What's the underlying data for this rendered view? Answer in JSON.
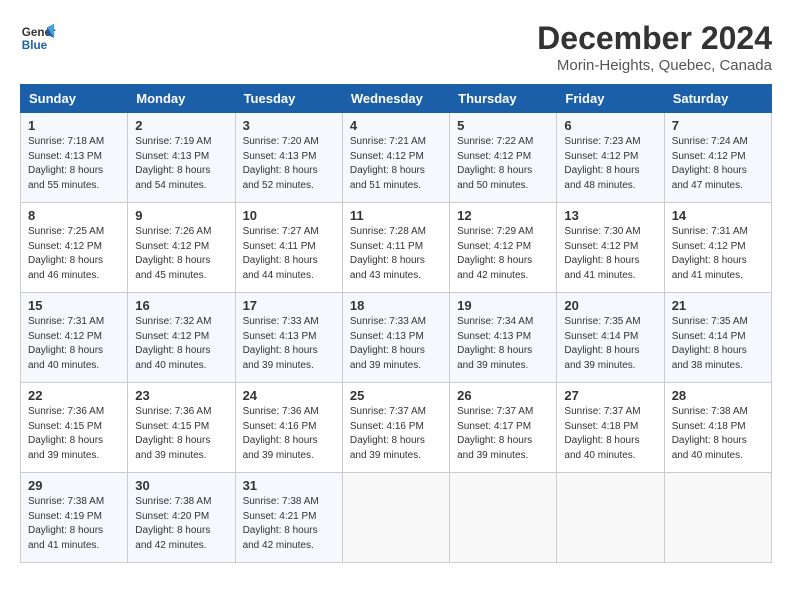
{
  "header": {
    "logo_line1": "General",
    "logo_line2": "Blue",
    "month": "December 2024",
    "location": "Morin-Heights, Quebec, Canada"
  },
  "columns": [
    "Sunday",
    "Monday",
    "Tuesday",
    "Wednesday",
    "Thursday",
    "Friday",
    "Saturday"
  ],
  "weeks": [
    [
      {
        "day": "1",
        "sunrise": "Sunrise: 7:18 AM",
        "sunset": "Sunset: 4:13 PM",
        "daylight": "Daylight: 8 hours and 55 minutes."
      },
      {
        "day": "2",
        "sunrise": "Sunrise: 7:19 AM",
        "sunset": "Sunset: 4:13 PM",
        "daylight": "Daylight: 8 hours and 54 minutes."
      },
      {
        "day": "3",
        "sunrise": "Sunrise: 7:20 AM",
        "sunset": "Sunset: 4:13 PM",
        "daylight": "Daylight: 8 hours and 52 minutes."
      },
      {
        "day": "4",
        "sunrise": "Sunrise: 7:21 AM",
        "sunset": "Sunset: 4:12 PM",
        "daylight": "Daylight: 8 hours and 51 minutes."
      },
      {
        "day": "5",
        "sunrise": "Sunrise: 7:22 AM",
        "sunset": "Sunset: 4:12 PM",
        "daylight": "Daylight: 8 hours and 50 minutes."
      },
      {
        "day": "6",
        "sunrise": "Sunrise: 7:23 AM",
        "sunset": "Sunset: 4:12 PM",
        "daylight": "Daylight: 8 hours and 48 minutes."
      },
      {
        "day": "7",
        "sunrise": "Sunrise: 7:24 AM",
        "sunset": "Sunset: 4:12 PM",
        "daylight": "Daylight: 8 hours and 47 minutes."
      }
    ],
    [
      {
        "day": "8",
        "sunrise": "Sunrise: 7:25 AM",
        "sunset": "Sunset: 4:12 PM",
        "daylight": "Daylight: 8 hours and 46 minutes."
      },
      {
        "day": "9",
        "sunrise": "Sunrise: 7:26 AM",
        "sunset": "Sunset: 4:12 PM",
        "daylight": "Daylight: 8 hours and 45 minutes."
      },
      {
        "day": "10",
        "sunrise": "Sunrise: 7:27 AM",
        "sunset": "Sunset: 4:11 PM",
        "daylight": "Daylight: 8 hours and 44 minutes."
      },
      {
        "day": "11",
        "sunrise": "Sunrise: 7:28 AM",
        "sunset": "Sunset: 4:11 PM",
        "daylight": "Daylight: 8 hours and 43 minutes."
      },
      {
        "day": "12",
        "sunrise": "Sunrise: 7:29 AM",
        "sunset": "Sunset: 4:12 PM",
        "daylight": "Daylight: 8 hours and 42 minutes."
      },
      {
        "day": "13",
        "sunrise": "Sunrise: 7:30 AM",
        "sunset": "Sunset: 4:12 PM",
        "daylight": "Daylight: 8 hours and 41 minutes."
      },
      {
        "day": "14",
        "sunrise": "Sunrise: 7:31 AM",
        "sunset": "Sunset: 4:12 PM",
        "daylight": "Daylight: 8 hours and 41 minutes."
      }
    ],
    [
      {
        "day": "15",
        "sunrise": "Sunrise: 7:31 AM",
        "sunset": "Sunset: 4:12 PM",
        "daylight": "Daylight: 8 hours and 40 minutes."
      },
      {
        "day": "16",
        "sunrise": "Sunrise: 7:32 AM",
        "sunset": "Sunset: 4:12 PM",
        "daylight": "Daylight: 8 hours and 40 minutes."
      },
      {
        "day": "17",
        "sunrise": "Sunrise: 7:33 AM",
        "sunset": "Sunset: 4:13 PM",
        "daylight": "Daylight: 8 hours and 39 minutes."
      },
      {
        "day": "18",
        "sunrise": "Sunrise: 7:33 AM",
        "sunset": "Sunset: 4:13 PM",
        "daylight": "Daylight: 8 hours and 39 minutes."
      },
      {
        "day": "19",
        "sunrise": "Sunrise: 7:34 AM",
        "sunset": "Sunset: 4:13 PM",
        "daylight": "Daylight: 8 hours and 39 minutes."
      },
      {
        "day": "20",
        "sunrise": "Sunrise: 7:35 AM",
        "sunset": "Sunset: 4:14 PM",
        "daylight": "Daylight: 8 hours and 39 minutes."
      },
      {
        "day": "21",
        "sunrise": "Sunrise: 7:35 AM",
        "sunset": "Sunset: 4:14 PM",
        "daylight": "Daylight: 8 hours and 38 minutes."
      }
    ],
    [
      {
        "day": "22",
        "sunrise": "Sunrise: 7:36 AM",
        "sunset": "Sunset: 4:15 PM",
        "daylight": "Daylight: 8 hours and 39 minutes."
      },
      {
        "day": "23",
        "sunrise": "Sunrise: 7:36 AM",
        "sunset": "Sunset: 4:15 PM",
        "daylight": "Daylight: 8 hours and 39 minutes."
      },
      {
        "day": "24",
        "sunrise": "Sunrise: 7:36 AM",
        "sunset": "Sunset: 4:16 PM",
        "daylight": "Daylight: 8 hours and 39 minutes."
      },
      {
        "day": "25",
        "sunrise": "Sunrise: 7:37 AM",
        "sunset": "Sunset: 4:16 PM",
        "daylight": "Daylight: 8 hours and 39 minutes."
      },
      {
        "day": "26",
        "sunrise": "Sunrise: 7:37 AM",
        "sunset": "Sunset: 4:17 PM",
        "daylight": "Daylight: 8 hours and 39 minutes."
      },
      {
        "day": "27",
        "sunrise": "Sunrise: 7:37 AM",
        "sunset": "Sunset: 4:18 PM",
        "daylight": "Daylight: 8 hours and 40 minutes."
      },
      {
        "day": "28",
        "sunrise": "Sunrise: 7:38 AM",
        "sunset": "Sunset: 4:18 PM",
        "daylight": "Daylight: 8 hours and 40 minutes."
      }
    ],
    [
      {
        "day": "29",
        "sunrise": "Sunrise: 7:38 AM",
        "sunset": "Sunset: 4:19 PM",
        "daylight": "Daylight: 8 hours and 41 minutes."
      },
      {
        "day": "30",
        "sunrise": "Sunrise: 7:38 AM",
        "sunset": "Sunset: 4:20 PM",
        "daylight": "Daylight: 8 hours and 42 minutes."
      },
      {
        "day": "31",
        "sunrise": "Sunrise: 7:38 AM",
        "sunset": "Sunset: 4:21 PM",
        "daylight": "Daylight: 8 hours and 42 minutes."
      },
      null,
      null,
      null,
      null
    ]
  ]
}
